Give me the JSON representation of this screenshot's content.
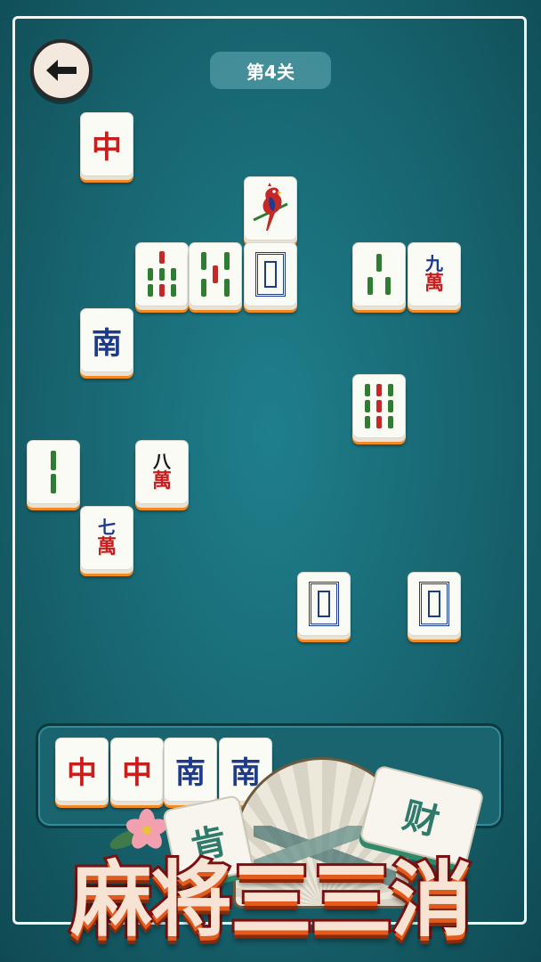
{
  "header": {
    "level_label": "第4关"
  },
  "colors": {
    "background": "#17646f",
    "tile_face": "#fbfbf6",
    "tile_edge": "#f08a24",
    "red": "#c81e1e",
    "blue": "#1d3b8c",
    "green": "#1f7a3a"
  },
  "board_tiles": [
    {
      "id": "t1",
      "kind": "honor",
      "text": "中",
      "color": "red"
    },
    {
      "id": "t2",
      "kind": "bird",
      "icon": "bird-icon"
    },
    {
      "id": "t3",
      "kind": "bamboo",
      "count": 6
    },
    {
      "id": "t4",
      "kind": "bamboo",
      "count": 5
    },
    {
      "id": "t5",
      "kind": "white-dragon",
      "icon": "white-dragon-icon"
    },
    {
      "id": "t6",
      "kind": "bamboo",
      "count": 3
    },
    {
      "id": "t7",
      "kind": "character",
      "num": "九",
      "suffix": "萬"
    },
    {
      "id": "t8",
      "kind": "honor",
      "text": "南",
      "color": "blue"
    },
    {
      "id": "t9",
      "kind": "bamboo",
      "count": 9
    },
    {
      "id": "t10",
      "kind": "bamboo",
      "count": 2
    },
    {
      "id": "t11",
      "kind": "character",
      "num": "八",
      "suffix": "萬"
    },
    {
      "id": "t12",
      "kind": "character",
      "num": "七",
      "suffix": "萬"
    },
    {
      "id": "t13",
      "kind": "white-dragon",
      "icon": "white-dragon-icon"
    },
    {
      "id": "t14",
      "kind": "white-dragon",
      "icon": "white-dragon-icon"
    }
  ],
  "tray": {
    "tiles": [
      {
        "text": "中",
        "color": "red"
      },
      {
        "text": "中",
        "color": "red"
      },
      {
        "text": "南",
        "color": "blue"
      },
      {
        "text": "南",
        "color": "blue"
      }
    ]
  },
  "banner": {
    "title": "麻将三三消",
    "decor_tiles": [
      "肯",
      "财"
    ]
  },
  "icons": {
    "back": "back-arrow-icon"
  }
}
